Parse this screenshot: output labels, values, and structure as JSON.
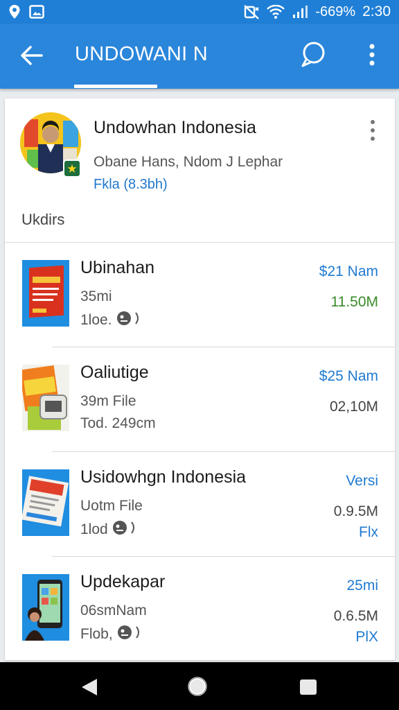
{
  "status_bar": {
    "battery_text": "-669%",
    "time": "2:30",
    "icons": [
      "location-icon",
      "image-icon",
      "mute-icon",
      "wifi-icon",
      "signal-icon"
    ]
  },
  "app_bar": {
    "title": "UNDOWANI N",
    "icons": [
      "back-arrow-icon",
      "chat-icon",
      "more-vert-icon"
    ],
    "accent_color": "#2a86db"
  },
  "channel": {
    "name": "Undowhan Indonesia",
    "subtitle": "Obane Hans, Ndom J Lephar",
    "link": "Fkla (8.3bh)",
    "section_label": "Ukdirs"
  },
  "items": [
    {
      "title": "Ubinahan",
      "line2": "35mi",
      "line3": "1loe.",
      "right1": "$21 Nam",
      "right2": "11.50M",
      "right3": ""
    },
    {
      "title": "Oaliutige",
      "line2": "39m File",
      "line3": "Tod. 249cm",
      "right1": "$25 Nam",
      "right2": "02,10M",
      "right3": ""
    },
    {
      "title": "Usidowhgn Indonesia",
      "line2": "Uotm File",
      "line3": "1lod",
      "right1": "Versi",
      "right2": "0.9.5M",
      "right3": "Flx"
    },
    {
      "title": "Updekapar",
      "line2": "06smNam",
      "line3": "Flob,",
      "right1": "25mi",
      "right2": "0.6.5M",
      "right3": "PlX"
    }
  ],
  "nav_bar": {
    "icons": [
      "nav-back-icon",
      "nav-home-icon",
      "nav-recents-icon"
    ]
  }
}
